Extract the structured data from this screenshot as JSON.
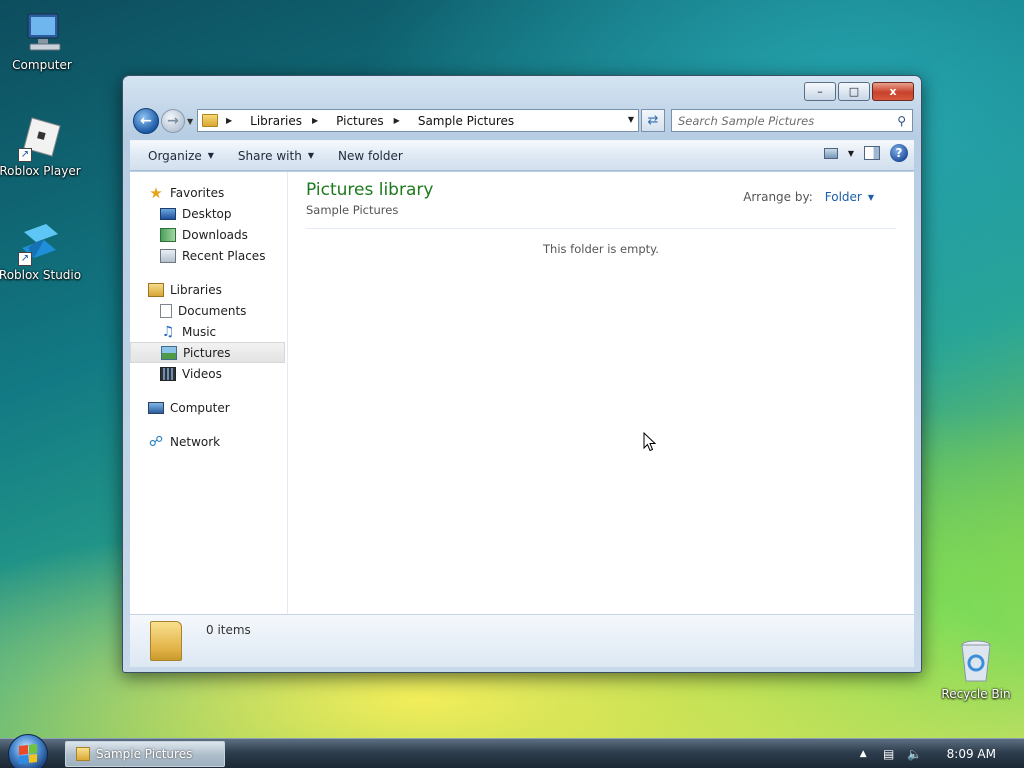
{
  "desktop": {
    "icons": [
      {
        "label": "Computer"
      },
      {
        "label": "Roblox Player"
      },
      {
        "label": "Roblox Studio"
      },
      {
        "label": "Recycle Bin"
      }
    ]
  },
  "window": {
    "caption": {
      "minimize": "–",
      "maximize": "□",
      "close": "x"
    },
    "address": {
      "crumbs": [
        "Libraries",
        "Pictures",
        "Sample Pictures"
      ]
    },
    "search": {
      "placeholder": "Search Sample Pictures"
    },
    "toolbar": {
      "organize": "Organize",
      "share_with": "Share with",
      "new_folder": "New folder"
    },
    "nav_pane": {
      "favorites": {
        "label": "Favorites",
        "items": [
          "Desktop",
          "Downloads",
          "Recent Places"
        ]
      },
      "libraries": {
        "label": "Libraries",
        "items": [
          "Documents",
          "Music",
          "Pictures",
          "Videos"
        ],
        "selected": "Pictures"
      },
      "computer": {
        "label": "Computer"
      },
      "network": {
        "label": "Network"
      }
    },
    "content": {
      "title": "Pictures library",
      "subtitle": "Sample Pictures",
      "arrange_label": "Arrange by:",
      "arrange_value": "Folder",
      "empty_message": "This folder is empty."
    },
    "details": {
      "item_count": "0 items"
    }
  },
  "taskbar": {
    "task_label": "Sample Pictures",
    "clock": "8:09 AM"
  },
  "colors": {
    "library_title": "#1c7a1c",
    "link": "#1d5ea9"
  }
}
